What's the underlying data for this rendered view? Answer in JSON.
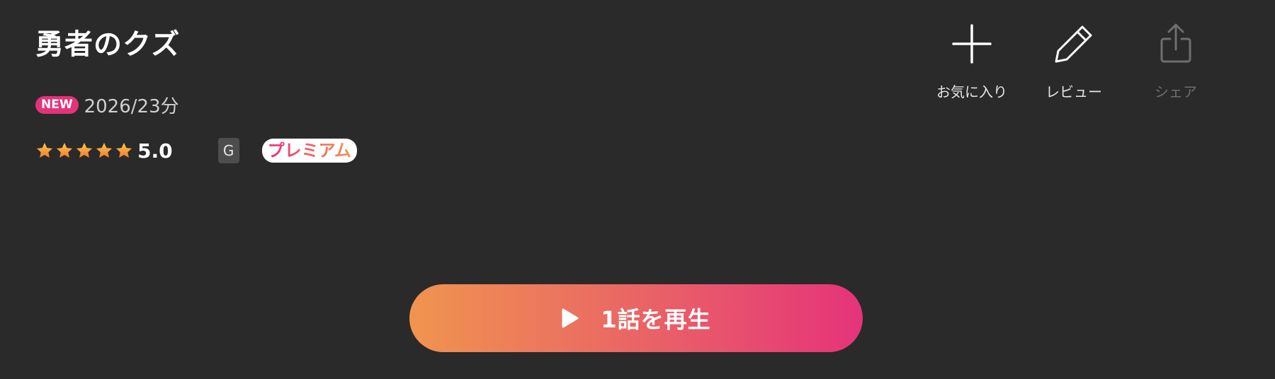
{
  "title": "勇者のクズ",
  "meta": {
    "new_badge": "NEW",
    "year_duration": "2026/23分"
  },
  "rating": {
    "value": "5.0",
    "stars_filled": 5,
    "stars_total": 5,
    "star_icon": "star-icon"
  },
  "age_rating": "G",
  "premium_badge": "プレミアム",
  "actions": [
    {
      "label": "お気に入り",
      "icon": "plus-icon"
    },
    {
      "label": "レビュー",
      "icon": "pencil-icon"
    },
    {
      "label": "シェア",
      "icon": "share-icon",
      "disabled": true
    }
  ],
  "play_button": {
    "label": "1話を再生",
    "icon": "play-icon"
  },
  "colors": {
    "background": "#2a2a2a",
    "new_badge": "#e3337a",
    "gradient_start": "#f0944f",
    "gradient_end": "#e5337a",
    "disabled_text": "#6e6e6e"
  }
}
